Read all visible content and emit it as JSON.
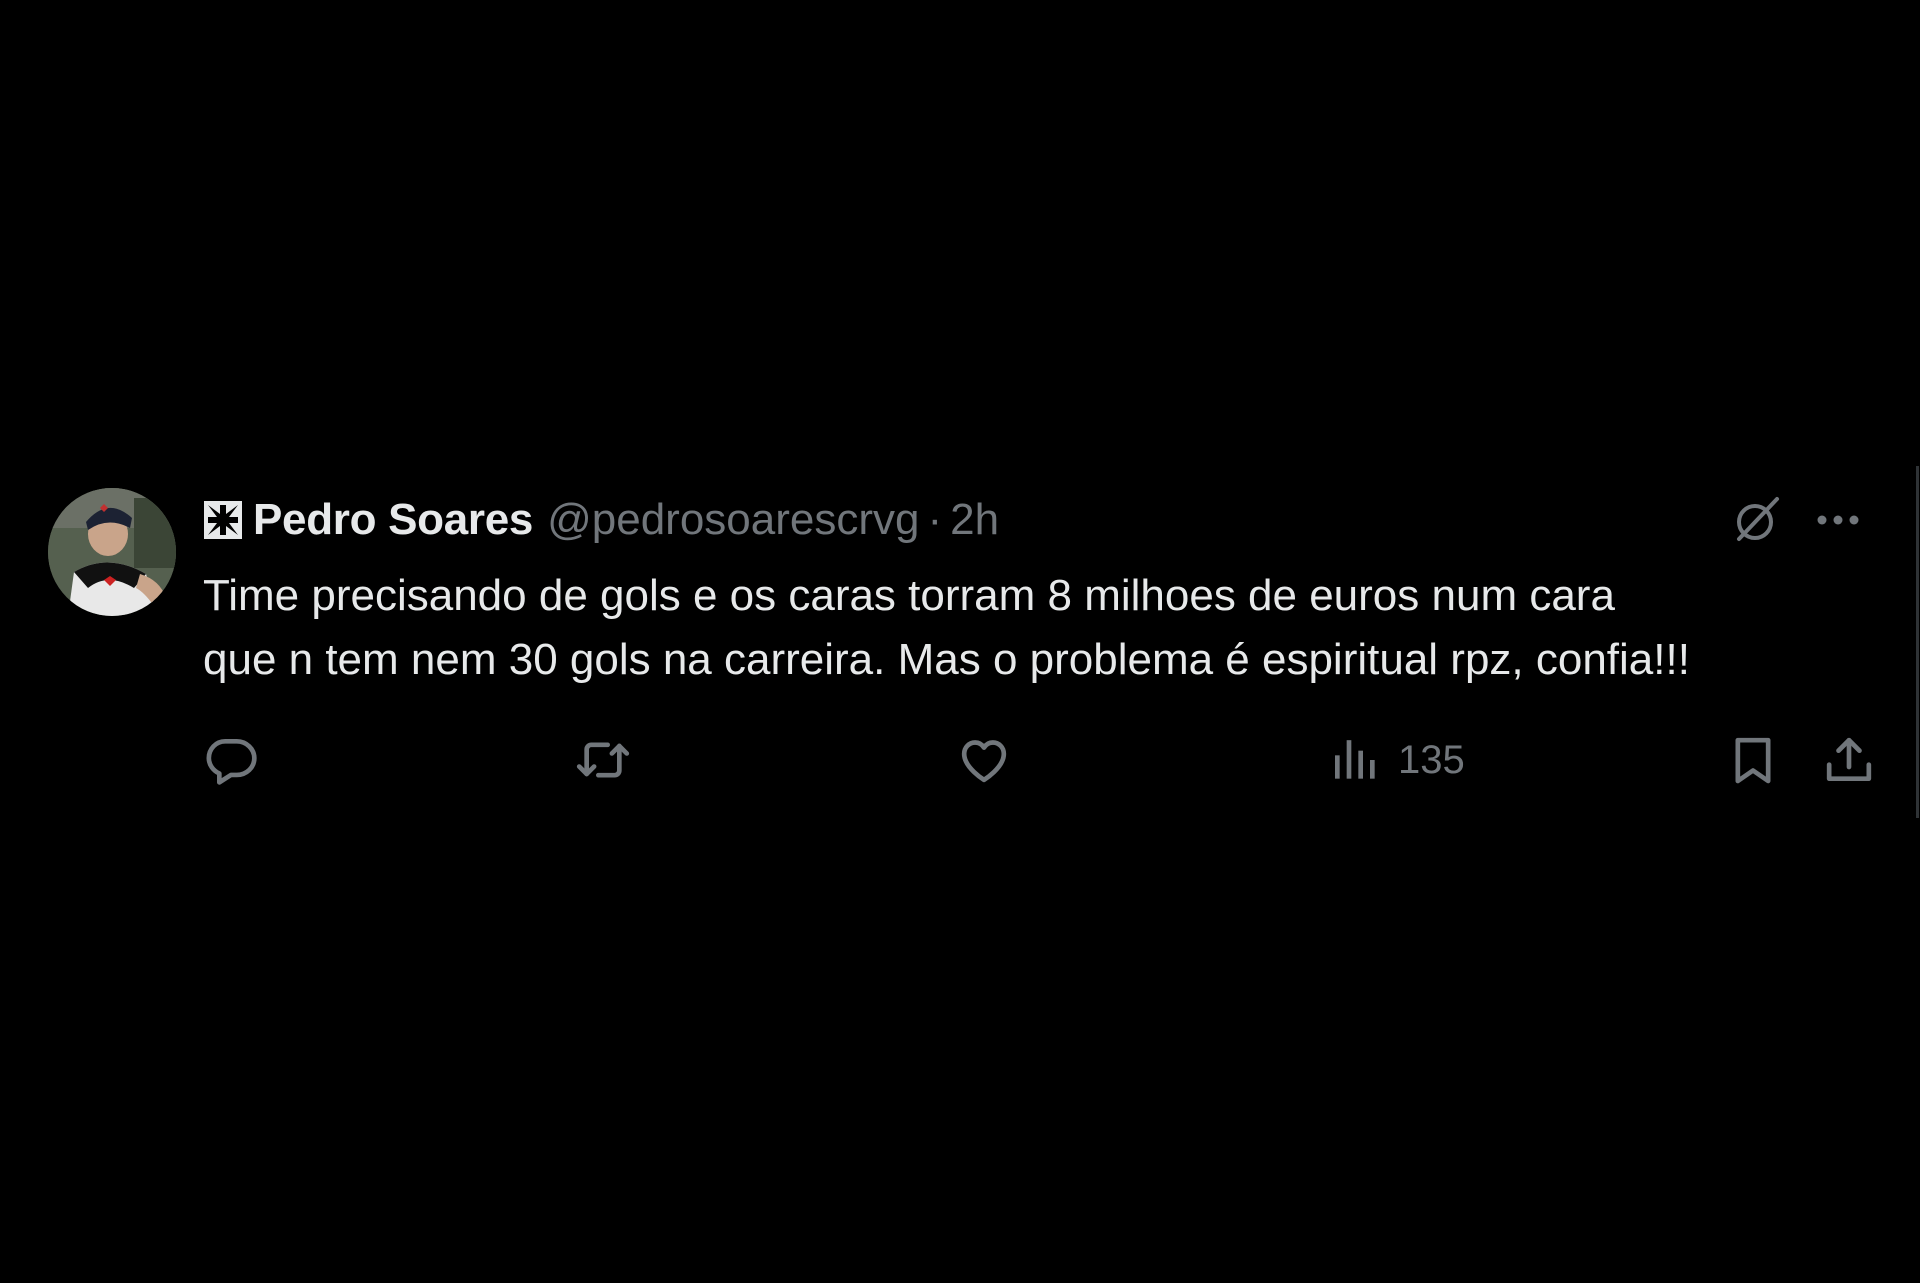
{
  "tweet": {
    "author": {
      "display_name": "Pedro Soares",
      "handle": "@pedrosoarescrvg",
      "name_prefix_icon": "cross-pattee-icon"
    },
    "separator": "·",
    "timestamp": "2h",
    "text": "Time precisando de gols e os caras torram 8 milhoes de euros num cara\nque n tem nem 30 gols na carreira. Mas o problema é espiritual rpz, confia!!!",
    "actions": {
      "reply": {
        "icon": "reply-icon",
        "count": ""
      },
      "retweet": {
        "icon": "retweet-icon",
        "count": ""
      },
      "like": {
        "icon": "heart-icon",
        "count": ""
      },
      "views": {
        "icon": "views-icon",
        "count": "135"
      },
      "bookmark": {
        "icon": "bookmark-icon"
      },
      "share": {
        "icon": "share-icon"
      }
    },
    "header_actions": {
      "grok": {
        "icon": "grok-icon"
      },
      "more": {
        "icon": "more-icon"
      }
    }
  },
  "colors": {
    "background": "#000000",
    "primary_text": "#e7e9ea",
    "secondary_text": "#71767b"
  }
}
